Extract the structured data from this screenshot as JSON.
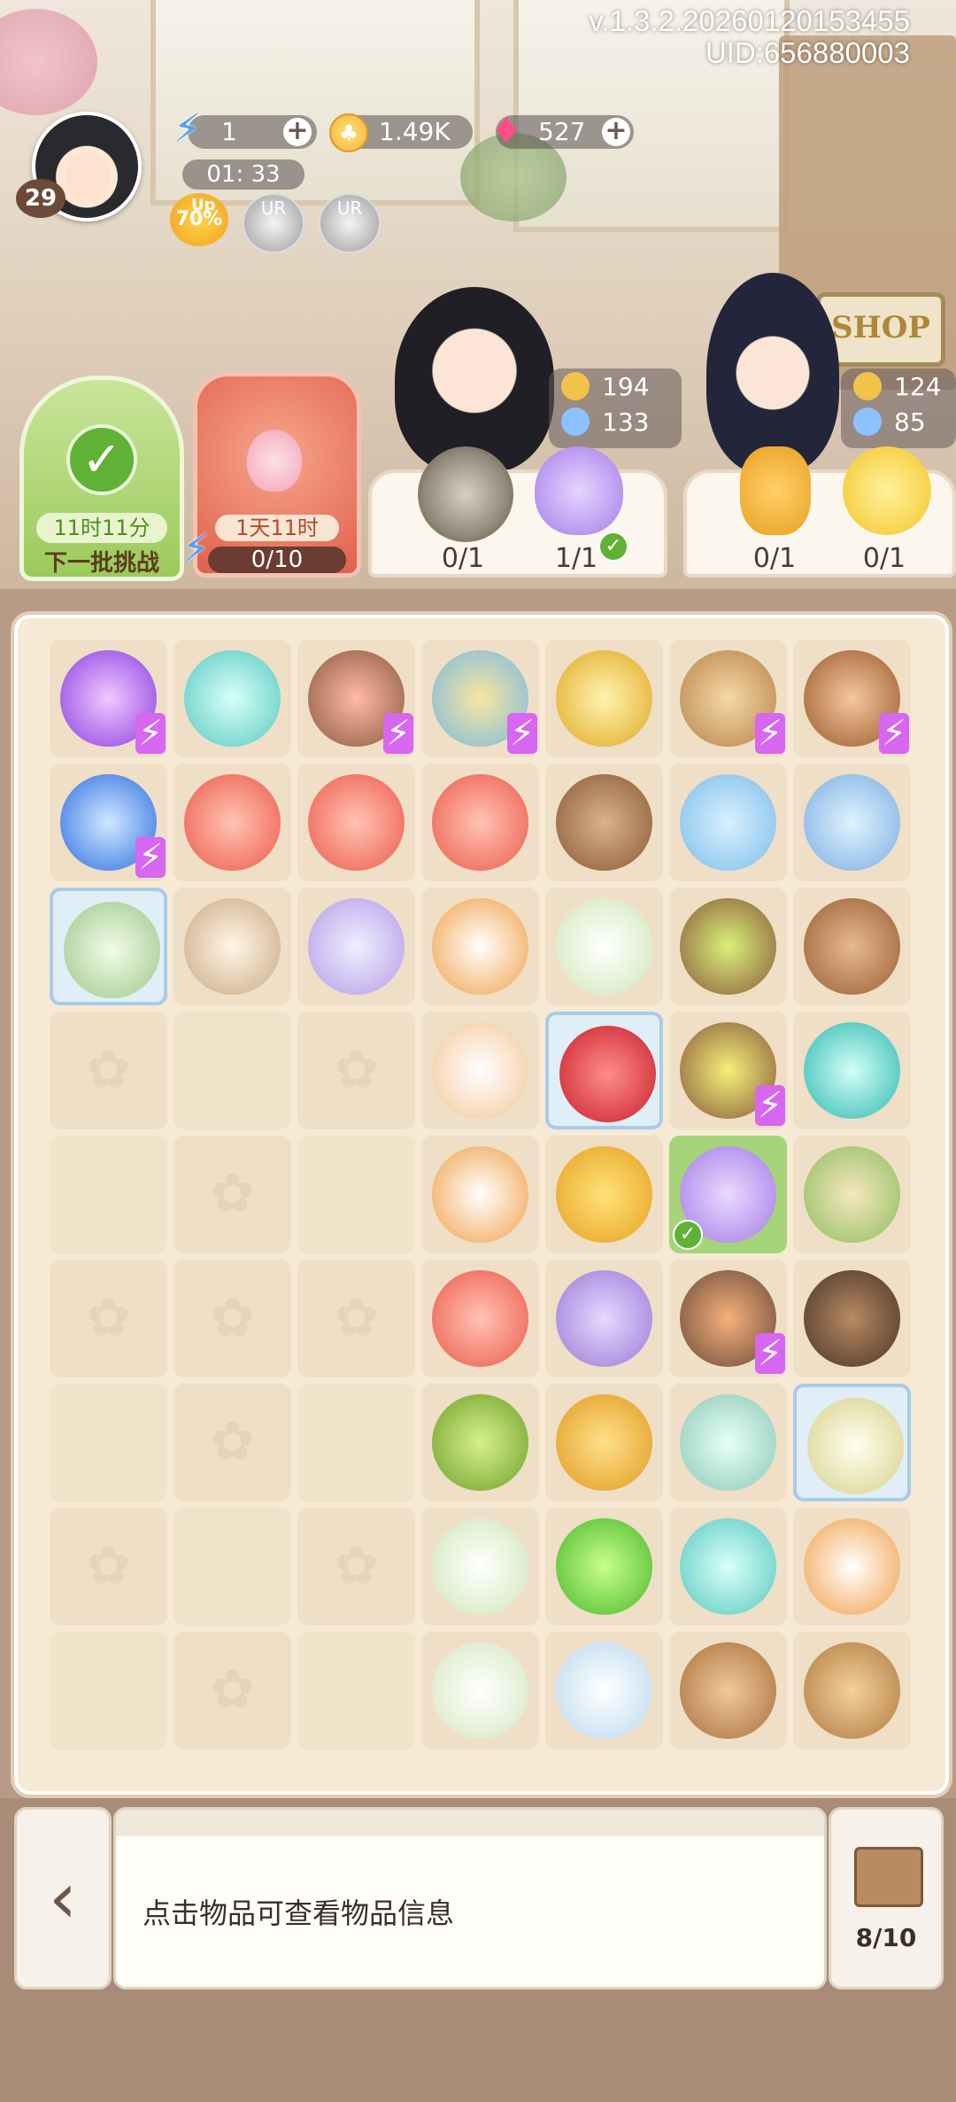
{
  "header": {
    "version": "v.1.3.2.20260120153455",
    "uid": "UID:656880003",
    "level": "29",
    "energy": "1",
    "energy_timer": "01: 33",
    "gold": "1.49K",
    "gems": "527",
    "up_badge": "70%",
    "up_label": "Up",
    "ur_label_1": "UR",
    "ur_label_2": "UR",
    "shop_label": "SHOP"
  },
  "challenge": {
    "time_left": "11时11分",
    "label": "下一批挑战"
  },
  "event_card": {
    "time_left": "1天11时",
    "progress": "0/10"
  },
  "orders": [
    {
      "coin": "194",
      "butterfly": "133",
      "counts": [
        "0/1",
        "1/1"
      ]
    },
    {
      "coin": "124",
      "butterfly": "85",
      "counts": [
        "0/1",
        "0/1"
      ]
    }
  ],
  "bottom": {
    "back_icon": "chevron-left-icon",
    "info_text": "点击物品可查看物品信息",
    "storage_label": "8/10"
  },
  "colors": {
    "accent": "#d767f0",
    "board": "#f6ead5",
    "success": "#5fb236"
  },
  "board_items": [
    [
      "vortex-purple",
      "puzzle-pieces",
      "flower-bed",
      "garden-bridge",
      "perfume-bottle",
      "cabinet-shelf",
      "teapot-stove"
    ],
    [
      "vortex-blue",
      "red-fish",
      "red-fish",
      "red-fish",
      "wooden-bookshelf",
      "fishbowl",
      "blue-bottle"
    ],
    [
      "glass-dome-plant",
      "hourglass",
      "crystal-cube",
      "clownfish",
      "calla-lily",
      "sprout-plot",
      "small-cabinet"
    ],
    [
      "empty",
      "empty",
      "empty",
      "cat-teacup",
      "cherry-frozen",
      "sprout-plot-lit",
      "vortex-teal"
    ],
    [
      "empty",
      "empty",
      "empty",
      "clownfish",
      "gold-coins",
      "purple-drop",
      "gazebo"
    ],
    [
      "empty",
      "empty",
      "empty",
      "red-fish",
      "dome-flower",
      "teapot-fire",
      "clay-stove"
    ],
    [
      "empty",
      "empty",
      "empty",
      "green-grapes",
      "amber-stone",
      "glass-vase",
      "tea-cup-frozen"
    ],
    [
      "empty",
      "empty",
      "empty",
      "calla-lily",
      "green-slime",
      "puzzle-pieces",
      "clownfish"
    ],
    [
      "empty",
      "empty",
      "empty",
      "calla-lilies",
      "water-drop",
      "small-stool",
      "work-desk"
    ]
  ]
}
